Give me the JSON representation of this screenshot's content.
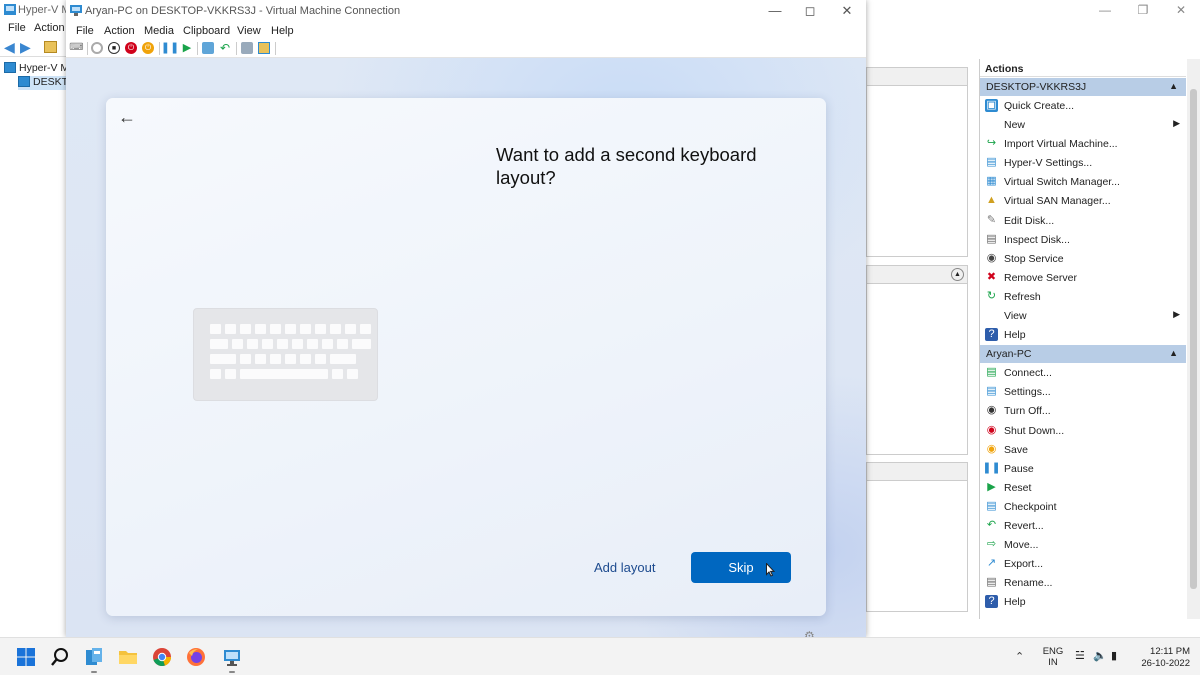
{
  "hyperv": {
    "title": "Hyper-V Ma",
    "menu": [
      "File",
      "Action"
    ],
    "tree": {
      "root": "Hyper-V Ma",
      "server": "DESKTO"
    },
    "actions_title": "Actions",
    "server_group": {
      "name": "DESKTOP-VKKRS3J",
      "items": [
        {
          "label": "Quick Create...",
          "icon": "quick-create-icon"
        },
        {
          "label": "New",
          "icon": "",
          "submenu": true
        },
        {
          "label": "Import Virtual Machine...",
          "icon": "import-icon"
        },
        {
          "label": "Hyper-V Settings...",
          "icon": "settings-icon"
        },
        {
          "label": "Virtual Switch Manager...",
          "icon": "switch-icon"
        },
        {
          "label": "Virtual SAN Manager...",
          "icon": "san-icon"
        },
        {
          "label": "Edit Disk...",
          "icon": "edit-disk-icon"
        },
        {
          "label": "Inspect Disk...",
          "icon": "inspect-disk-icon"
        },
        {
          "label": "Stop Service",
          "icon": "stop-icon"
        },
        {
          "label": "Remove Server",
          "icon": "remove-icon"
        },
        {
          "label": "Refresh",
          "icon": "refresh-icon"
        },
        {
          "label": "View",
          "icon": "",
          "submenu": true
        },
        {
          "label": "Help",
          "icon": "help-icon"
        }
      ]
    },
    "vm_group": {
      "name": "Aryan-PC",
      "items": [
        {
          "label": "Connect...",
          "icon": "connect-icon"
        },
        {
          "label": "Settings...",
          "icon": "settings-icon"
        },
        {
          "label": "Turn Off...",
          "icon": "turn-off-icon"
        },
        {
          "label": "Shut Down...",
          "icon": "shutdown-icon"
        },
        {
          "label": "Save",
          "icon": "save-icon"
        },
        {
          "label": "Pause",
          "icon": "pause-icon"
        },
        {
          "label": "Reset",
          "icon": "reset-icon"
        },
        {
          "label": "Checkpoint",
          "icon": "checkpoint-icon"
        },
        {
          "label": "Revert...",
          "icon": "revert-icon"
        },
        {
          "label": "Move...",
          "icon": "move-icon"
        },
        {
          "label": "Export...",
          "icon": "export-icon"
        },
        {
          "label": "Rename...",
          "icon": "rename-icon"
        },
        {
          "label": "Help",
          "icon": "help-icon"
        }
      ]
    }
  },
  "vm": {
    "title": "Aryan-PC on DESKTOP-VKKRS3J - Virtual Machine Connection",
    "menu": [
      "File",
      "Action",
      "Media",
      "Clipboard",
      "View",
      "Help"
    ]
  },
  "oobe": {
    "heading": "Want to add a second keyboard layout?",
    "add_layout": "Add layout",
    "skip": "Skip"
  },
  "taskbar": {
    "lang_line1": "ENG",
    "lang_line2": "IN",
    "time": "12:11 PM",
    "date": "26-10-2022"
  },
  "colors": {
    "accent": "#0067c0",
    "action_group_bg": "#b8cde6",
    "link": "#1d4b8f"
  }
}
